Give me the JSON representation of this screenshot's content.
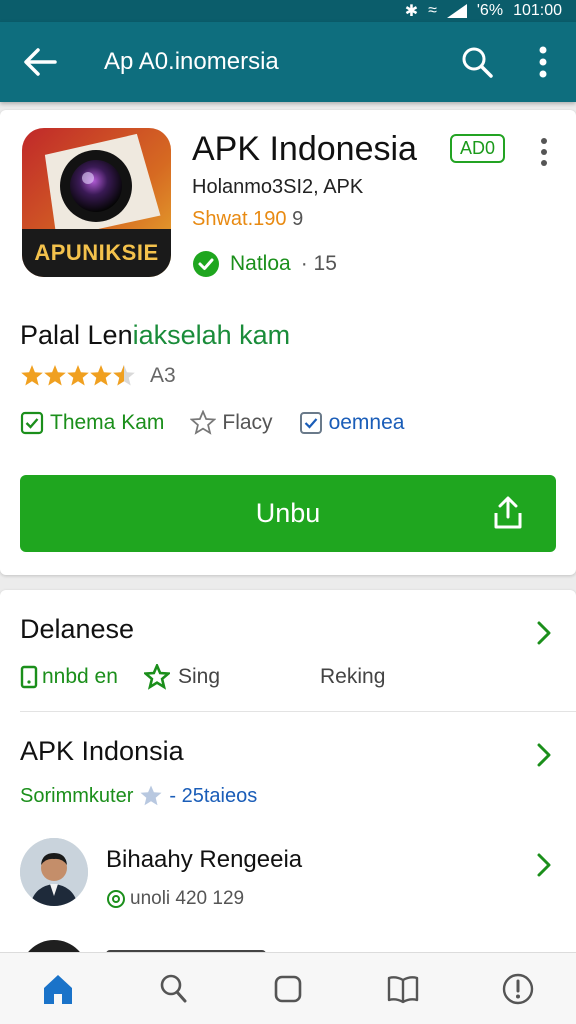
{
  "status_bar": {
    "battery": "'6%",
    "time": "101:00"
  },
  "app_bar": {
    "title": "Ap A0.inomersia"
  },
  "app": {
    "name": "APK Indonesia",
    "badge": "AD0",
    "icon_label": "APUNIKSIE",
    "developer": "Holanmo3SI2,  APK",
    "size_label": "Shwat.190",
    "size_extra": "9",
    "verified_label": "Natloa",
    "verified_count": "· 15",
    "subtitle_a": "Palal Len",
    "subtitle_b": "iakselah kam",
    "rating": "A3",
    "rating_stars": 4.5,
    "tags": [
      "Thema Kam",
      "Flacy",
      "oemnea"
    ],
    "primary_button": "Unbu"
  },
  "section1": {
    "title": "Delanese",
    "items": [
      "nnbd en",
      "Sing",
      "Reking"
    ]
  },
  "section2": {
    "title": "APK Indonsia",
    "meta_a": "Sorimmkuter",
    "meta_b": "- 25taieos"
  },
  "list_item": {
    "name": "Bihaahy Rengeeia",
    "meta": "unoli 420  129"
  },
  "colors": {
    "app_bar": "#0e6e7e",
    "accent_green": "#1fa61f",
    "link_blue": "#1a5db8",
    "star": "#f0a020"
  },
  "bottom_nav": {
    "items": [
      "home-icon",
      "search-icon",
      "square-icon",
      "book-icon",
      "info-icon"
    ],
    "active": 0
  }
}
